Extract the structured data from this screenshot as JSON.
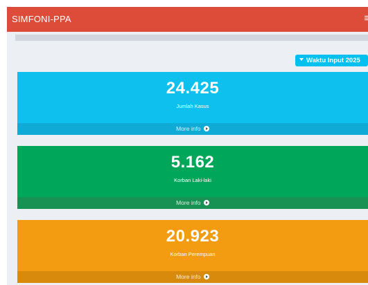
{
  "app": {
    "brand": "SIMFONI-PPA",
    "menu_icon": "hamburger-icon"
  },
  "filter": {
    "label": "Waktu Input 2025",
    "icon": "caret-down-icon"
  },
  "stats": [
    {
      "value": "24.425",
      "label": "Jumlah Kasus",
      "footer": "More info",
      "color": "#00c0ef"
    },
    {
      "value": "5.162",
      "label": "Korban Laki-laki",
      "footer": "More info",
      "color": "#00a65a"
    },
    {
      "value": "20.923",
      "label": "Korban Perempuan",
      "footer": "More info",
      "color": "#f39c12"
    }
  ],
  "colors": {
    "navbar": "#dd4b39",
    "background": "#ecf0f5"
  }
}
